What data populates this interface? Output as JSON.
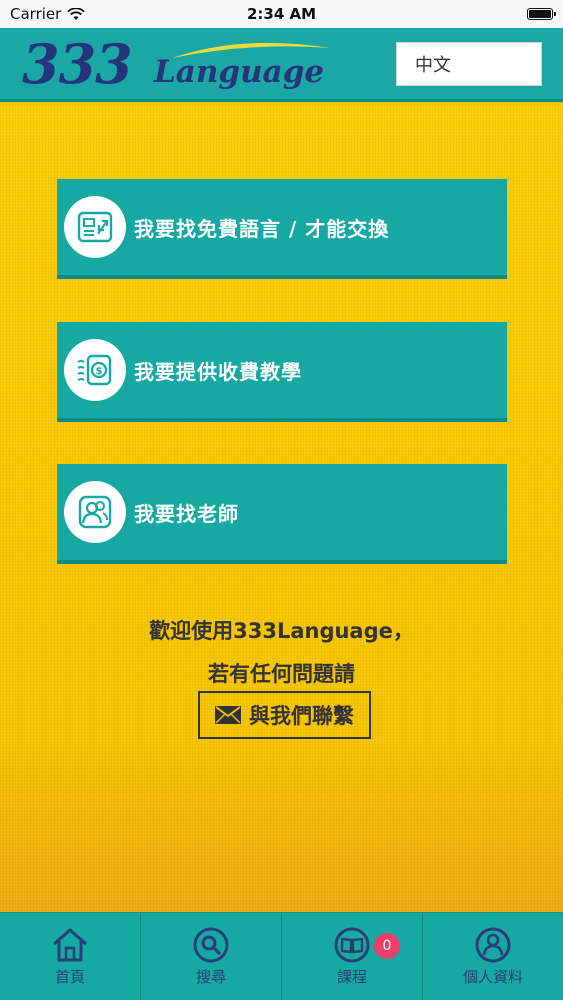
{
  "status_bar": {
    "carrier": "Carrier",
    "time": "2:34 AM"
  },
  "header": {
    "logo_number": "333",
    "logo_word": "Language",
    "language_value": "中文"
  },
  "menu": [
    {
      "label": "我要找免費語言 / 才能交換",
      "icon": "exchange-icon"
    },
    {
      "label": "我要提供收費教學",
      "icon": "paid-teaching-icon"
    },
    {
      "label": "我要找老師",
      "icon": "find-teacher-icon"
    }
  ],
  "welcome": {
    "line1": "歡迎使用333Language，",
    "line2": "若有任何問題請",
    "contact_label": "與我們聯繫"
  },
  "tabs": [
    {
      "label": "首頁",
      "icon": "home-icon"
    },
    {
      "label": "搜尋",
      "icon": "search-icon"
    },
    {
      "label": "課程",
      "icon": "book-icon",
      "badge": "0"
    },
    {
      "label": "個人資料",
      "icon": "profile-icon"
    }
  ],
  "colors": {
    "teal": "#16a8a2",
    "yellow": "#f6c400",
    "navy": "#24357a",
    "badge": "#ee3f6a"
  }
}
